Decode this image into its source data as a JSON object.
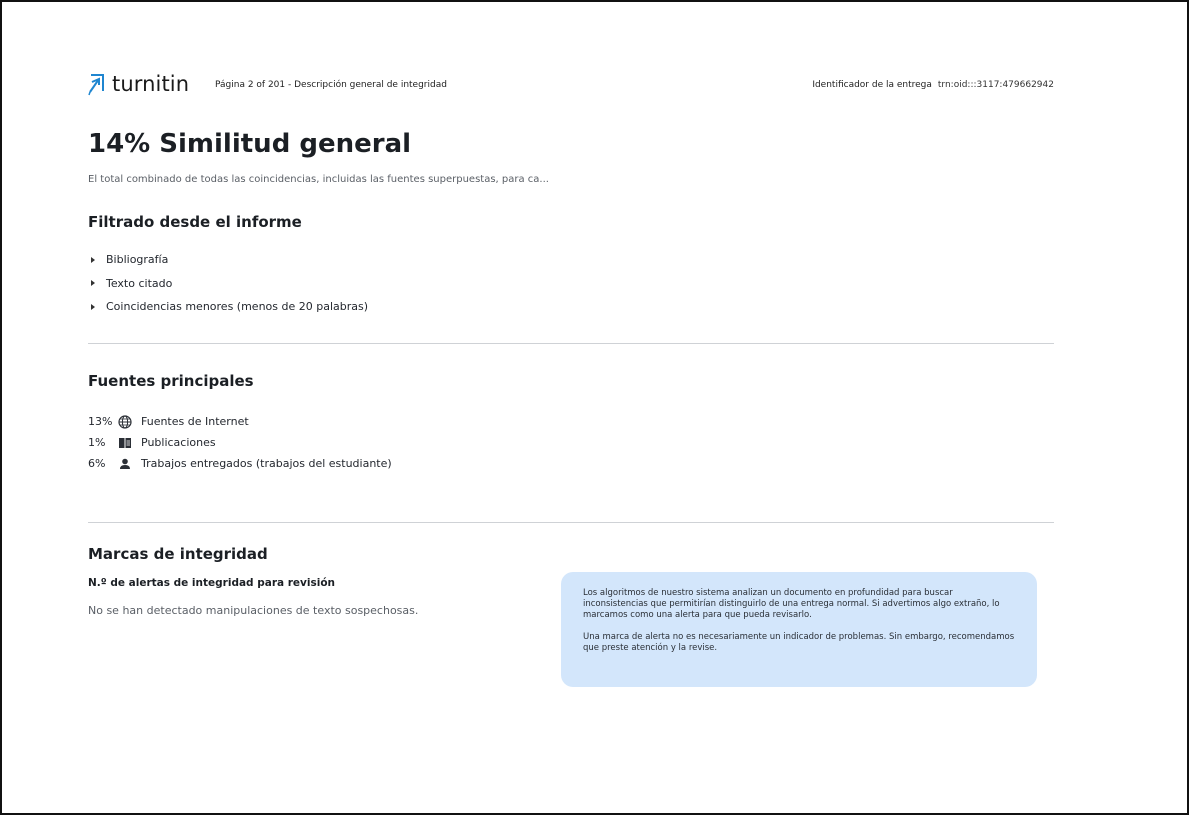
{
  "header": {
    "logo_text": "turnitin",
    "page_info": "Página 2 of 201 - Descripción general de integridad",
    "submission_label": "Identificador de la entrega",
    "submission_id": "trn:oid:::3117:479662942"
  },
  "summary": {
    "title": "14% Similitud general",
    "subtitle": "El total combinado de todas las coincidencias, incluidas las fuentes superpuestas, para ca..."
  },
  "filtered": {
    "heading": "Filtrado desde el informe",
    "items": [
      "Bibliografía",
      "Texto citado",
      "Coincidencias menores (menos de 20 palabras)"
    ]
  },
  "sources": {
    "heading": "Fuentes principales",
    "items": [
      {
        "percent": "13%",
        "icon": "globe-icon",
        "label": "Fuentes de Internet"
      },
      {
        "percent": "1%",
        "icon": "book-icon",
        "label": "Publicaciones"
      },
      {
        "percent": "6%",
        "icon": "person-icon",
        "label": "Trabajos entregados (trabajos del estudiante)"
      }
    ]
  },
  "integrity": {
    "heading": "Marcas de integridad",
    "alerts_label": "N.º de alertas de integridad para revisión",
    "alerts_text": "No se han detectado manipulaciones de texto sospechosas.",
    "info_paragraph_1": "Los algoritmos de nuestro sistema analizan un documento en profundidad para buscar inconsistencias que permitirían distinguirlo de una entrega normal. Si advertimos algo extraño, lo marcamos como una alerta para que pueda revisarlo.",
    "info_paragraph_2": "Una marca de alerta no es necesariamente un indicador de problemas. Sin embargo, recomendamos que preste atención y la revise."
  },
  "colors": {
    "logo_blue": "#1f86d0",
    "info_box_background": "#d3e6fb",
    "divider": "#cfd2d6"
  }
}
